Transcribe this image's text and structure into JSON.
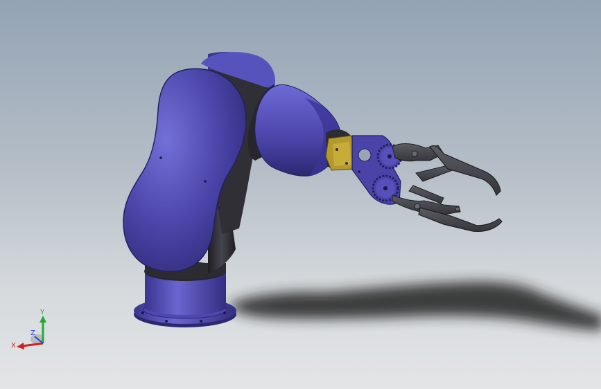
{
  "app": {
    "view_type": "3d-cad-model-viewport"
  },
  "model": {
    "subject": "six-axis-robot-arm-with-gear-gripper",
    "colors": {
      "body": "#4a44a8",
      "body_light": "#6a66d0",
      "body_dark": "#2c2870",
      "joint_dark": "#2e2e34",
      "gripper": "#4c4c54",
      "adapter": "#b49a2c",
      "shadow": "#2a2a2a"
    }
  },
  "triad": {
    "x_label": "X",
    "y_label": "Y",
    "z_label": "Z",
    "colors": {
      "x": "#cc2222",
      "y": "#22aa33",
      "z": "#3344cc"
    }
  },
  "background": {
    "top": "#93a3b4",
    "bottom": "#e3e5e6"
  }
}
